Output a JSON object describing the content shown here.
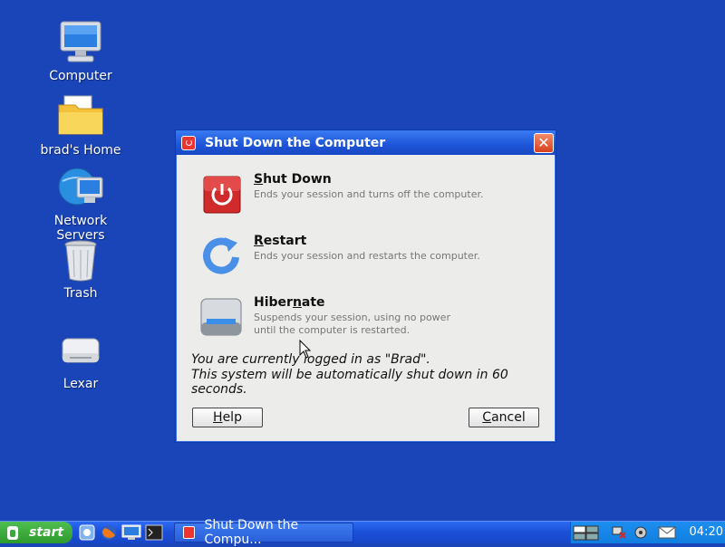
{
  "desktop": {
    "icons": [
      {
        "label": "Computer"
      },
      {
        "label": "brad's Home"
      },
      {
        "label": "Network Servers"
      },
      {
        "label": "Trash"
      },
      {
        "label": "Lexar"
      }
    ]
  },
  "dialog": {
    "title": "Shut Down the Computer",
    "options": [
      {
        "title_first": "S",
        "title_rest": "hut Down",
        "description": "Ends your session and turns off the computer."
      },
      {
        "title_first": "R",
        "title_rest": "estart",
        "description": "Ends your session and restarts the computer."
      },
      {
        "title_first_pre": "Hiber",
        "title_u": "n",
        "title_rest": "ate",
        "description": "Suspends your session, using no power\nuntil the computer is restarted."
      }
    ],
    "logged_in_msg": "You are currently logged in as \"Brad\".",
    "auto_shutdown_msg": "This system will be automatically shut down in 60 seconds.",
    "help_label_u": "H",
    "help_label_rest": "elp",
    "cancel_label_u": "C",
    "cancel_label_rest": "ancel"
  },
  "taskbar": {
    "start_label": "start",
    "task_label": "Shut Down the Compu...",
    "clock": "04:20"
  },
  "colors": {
    "desktop": "#1a45b8",
    "titlebar": "#1d55d8",
    "shutdown_red": "#d02a2a",
    "start_green": "#3aaa3a"
  }
}
